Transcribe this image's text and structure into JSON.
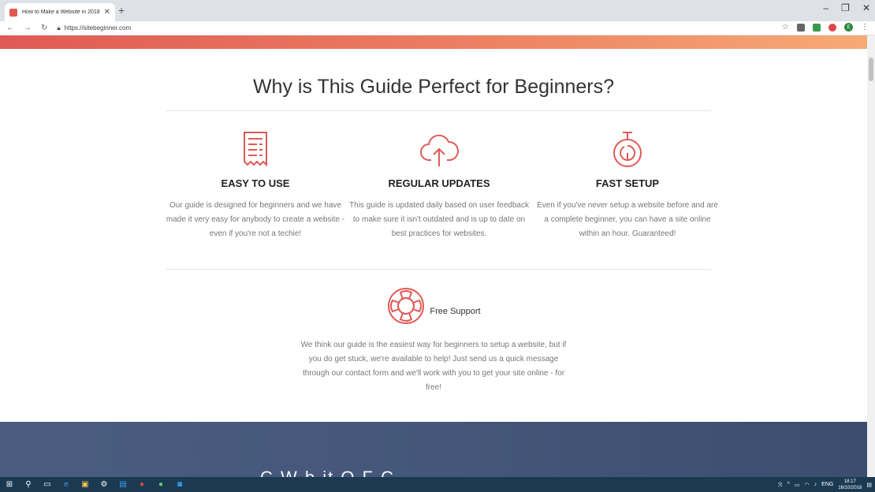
{
  "browser": {
    "tab_title": "How to Make a Website in 2018",
    "url": "https://sitebeginner.com"
  },
  "page": {
    "heading": "Why is This Guide Perfect for Beginners?",
    "features": [
      {
        "title": "EASY TO USE",
        "text": "Our guide is designed for beginners and we have made it very easy for anybody to create a website - even if you're not a techie!",
        "icon": "receipt-icon"
      },
      {
        "title": "REGULAR UPDATES",
        "text": "This guide is updated daily based on user feedback to make sure it isn't outdated and is up to date on best practices for websites.",
        "icon": "cloud-upload-icon"
      },
      {
        "title": "FAST SETUP",
        "text": "Even if you've never setup a website before and are a complete beginner, you can have a site online within an hour. Guaranteed!",
        "icon": "stopwatch-icon"
      }
    ],
    "support": {
      "label": "Free Support",
      "text": "We think our guide is the easiest way for beginners to setup a website, but if you do get stuck, we're available to help! Just send us a quick message through our contact form and we'll work with you to get your site online - for free!",
      "icon": "lifebuoy-icon"
    },
    "next_section_partial": "C        W b  it  O F  C"
  },
  "taskbar": {
    "time": "18:17",
    "date": "16/10/2018",
    "lang": "ENG"
  },
  "colors": {
    "accent": "#e05a55",
    "band_end": "#f7aa75",
    "dark_section": "#44577a"
  }
}
